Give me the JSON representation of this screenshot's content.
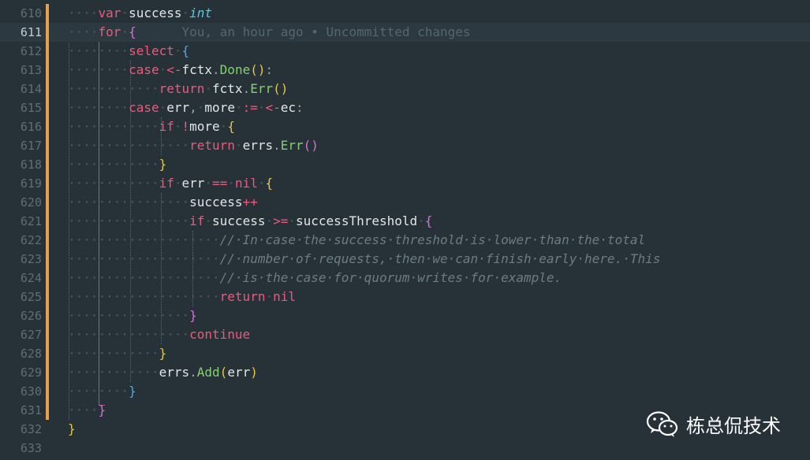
{
  "editor": {
    "lines": [
      {
        "n": "610",
        "current": false,
        "modified": true,
        "tokens": [
          [
            "ws",
            "····"
          ],
          [
            "kw",
            "var"
          ],
          [
            "ws",
            "·"
          ],
          [
            "id",
            "success"
          ],
          [
            "ws",
            "·"
          ],
          [
            "ty",
            "int"
          ]
        ]
      },
      {
        "n": "611",
        "current": true,
        "modified": true,
        "tokens": [
          [
            "ws",
            "····"
          ],
          [
            "kw",
            "for"
          ],
          [
            "ws",
            "·"
          ],
          [
            "b2",
            "{"
          ],
          [
            "blame",
            "      You, an hour ago • Uncommitted changes"
          ]
        ]
      },
      {
        "n": "612",
        "current": false,
        "modified": true,
        "tokens": [
          [
            "ws",
            "········"
          ],
          [
            "kw",
            "select"
          ],
          [
            "ws",
            "·"
          ],
          [
            "b3",
            "{"
          ]
        ]
      },
      {
        "n": "613",
        "current": false,
        "modified": true,
        "tokens": [
          [
            "ws",
            "········"
          ],
          [
            "kw",
            "case"
          ],
          [
            "ws",
            "·"
          ],
          [
            "op",
            "<-"
          ],
          [
            "id",
            "fctx"
          ],
          [
            "pu",
            "."
          ],
          [
            "fn",
            "Done"
          ],
          [
            "b1",
            "()"
          ],
          [
            "pu",
            ":"
          ]
        ]
      },
      {
        "n": "614",
        "current": false,
        "modified": true,
        "tokens": [
          [
            "ws",
            "············"
          ],
          [
            "kw",
            "return"
          ],
          [
            "ws",
            "·"
          ],
          [
            "id",
            "fctx"
          ],
          [
            "pu",
            "."
          ],
          [
            "fn",
            "Err"
          ],
          [
            "b1",
            "()"
          ]
        ]
      },
      {
        "n": "615",
        "current": false,
        "modified": true,
        "tokens": [
          [
            "ws",
            "········"
          ],
          [
            "kw",
            "case"
          ],
          [
            "ws",
            "·"
          ],
          [
            "id",
            "err"
          ],
          [
            "pu",
            ","
          ],
          [
            "ws",
            "·"
          ],
          [
            "id",
            "more"
          ],
          [
            "ws",
            "·"
          ],
          [
            "op",
            ":="
          ],
          [
            "ws",
            "·"
          ],
          [
            "op",
            "<-"
          ],
          [
            "id",
            "ec"
          ],
          [
            "pu",
            ":"
          ]
        ]
      },
      {
        "n": "616",
        "current": false,
        "modified": true,
        "tokens": [
          [
            "ws",
            "············"
          ],
          [
            "kw",
            "if"
          ],
          [
            "ws",
            "·"
          ],
          [
            "op",
            "!"
          ],
          [
            "id",
            "more"
          ],
          [
            "ws",
            "·"
          ],
          [
            "b1",
            "{"
          ]
        ]
      },
      {
        "n": "617",
        "current": false,
        "modified": true,
        "tokens": [
          [
            "ws",
            "················"
          ],
          [
            "kw",
            "return"
          ],
          [
            "ws",
            "·"
          ],
          [
            "id",
            "errs"
          ],
          [
            "pu",
            "."
          ],
          [
            "fn",
            "Err"
          ],
          [
            "b2",
            "()"
          ]
        ]
      },
      {
        "n": "618",
        "current": false,
        "modified": true,
        "tokens": [
          [
            "ws",
            "············"
          ],
          [
            "b1",
            "}"
          ]
        ]
      },
      {
        "n": "619",
        "current": false,
        "modified": true,
        "tokens": [
          [
            "ws",
            "············"
          ],
          [
            "kw",
            "if"
          ],
          [
            "ws",
            "·"
          ],
          [
            "id",
            "err"
          ],
          [
            "ws",
            "·"
          ],
          [
            "op",
            "=="
          ],
          [
            "ws",
            "·"
          ],
          [
            "kw",
            "nil"
          ],
          [
            "ws",
            "·"
          ],
          [
            "b1",
            "{"
          ]
        ]
      },
      {
        "n": "620",
        "current": false,
        "modified": true,
        "tokens": [
          [
            "ws",
            "················"
          ],
          [
            "id",
            "success"
          ],
          [
            "op",
            "++"
          ]
        ]
      },
      {
        "n": "621",
        "current": false,
        "modified": true,
        "tokens": [
          [
            "ws",
            "················"
          ],
          [
            "kw",
            "if"
          ],
          [
            "ws",
            "·"
          ],
          [
            "id",
            "success"
          ],
          [
            "ws",
            "·"
          ],
          [
            "op",
            ">="
          ],
          [
            "ws",
            "·"
          ],
          [
            "id",
            "successThreshold"
          ],
          [
            "ws",
            "·"
          ],
          [
            "b2",
            "{"
          ]
        ]
      },
      {
        "n": "622",
        "current": false,
        "modified": true,
        "tokens": [
          [
            "ws",
            "····················"
          ],
          [
            "cm",
            "//·In·case·the·success·threshold·is·lower·than·the·total"
          ]
        ]
      },
      {
        "n": "623",
        "current": false,
        "modified": true,
        "tokens": [
          [
            "ws",
            "····················"
          ],
          [
            "cm",
            "//·number·of·requests,·then·we·can·finish·early·here.·This"
          ]
        ]
      },
      {
        "n": "624",
        "current": false,
        "modified": true,
        "tokens": [
          [
            "ws",
            "····················"
          ],
          [
            "cm",
            "//·is·the·case·for·quorum·writes·for·example."
          ]
        ]
      },
      {
        "n": "625",
        "current": false,
        "modified": true,
        "tokens": [
          [
            "ws",
            "····················"
          ],
          [
            "kw",
            "return"
          ],
          [
            "ws",
            "·"
          ],
          [
            "kw",
            "nil"
          ]
        ]
      },
      {
        "n": "626",
        "current": false,
        "modified": true,
        "tokens": [
          [
            "ws",
            "················"
          ],
          [
            "b2",
            "}"
          ]
        ]
      },
      {
        "n": "627",
        "current": false,
        "modified": true,
        "tokens": [
          [
            "ws",
            "················"
          ],
          [
            "kw",
            "continue"
          ]
        ]
      },
      {
        "n": "628",
        "current": false,
        "modified": true,
        "tokens": [
          [
            "ws",
            "············"
          ],
          [
            "b1",
            "}"
          ]
        ]
      },
      {
        "n": "629",
        "current": false,
        "modified": true,
        "tokens": [
          [
            "ws",
            "············"
          ],
          [
            "id",
            "errs"
          ],
          [
            "pu",
            "."
          ],
          [
            "fn",
            "Add"
          ],
          [
            "b1",
            "("
          ],
          [
            "id",
            "err"
          ],
          [
            "b1",
            ")"
          ]
        ]
      },
      {
        "n": "630",
        "current": false,
        "modified": true,
        "tokens": [
          [
            "ws",
            "········"
          ],
          [
            "b3",
            "}"
          ]
        ]
      },
      {
        "n": "631",
        "current": false,
        "modified": true,
        "tokens": [
          [
            "ws",
            "····"
          ],
          [
            "b2",
            "}"
          ]
        ]
      },
      {
        "n": "632",
        "current": false,
        "modified": false,
        "tokens": [
          [
            "b1",
            "}"
          ]
        ]
      },
      {
        "n": "633",
        "current": false,
        "modified": false,
        "tokens": []
      }
    ]
  },
  "watermark": {
    "text": "栋总侃技术",
    "icon": "wechat-icon"
  },
  "colors": {
    "background": "#263238",
    "modified_bar": "#e6a14a",
    "keyword": "#f0587a",
    "function": "#83d26c",
    "type": "#56c6ea",
    "comment": "#6d7c84"
  }
}
